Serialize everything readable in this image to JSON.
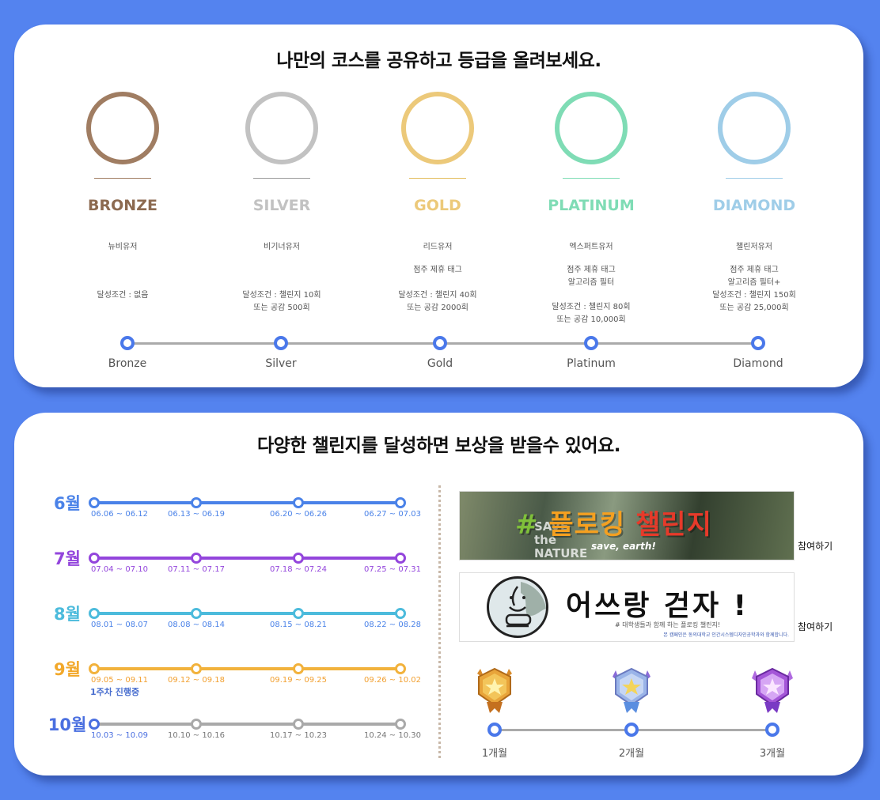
{
  "tiers_section": {
    "title": "나만의 코스를 공유하고 등급을 올려보세요.",
    "tiers": [
      {
        "name": "BRONZE",
        "color": "#a07d62",
        "rule_color": "#a07d62",
        "subtitle": "뉴비유저",
        "perks": "",
        "condition": "달성조건 : 없음"
      },
      {
        "name": "SILVER",
        "color": "#c2c2c2",
        "rule_color": "#9a9a9a",
        "subtitle": "비기너유저",
        "perks": "",
        "condition": "달성조건 : 챌린지 10회\n또는 공감 500회"
      },
      {
        "name": "GOLD",
        "color": "#ecc97a",
        "rule_color": "#e3bb5a",
        "subtitle": "리드유저",
        "perks": "점주 제휴 태그",
        "condition": "달성조건 : 챌린지 40회\n또는 공감 2000회"
      },
      {
        "name": "PLATINUM",
        "color": "#7fdcb5",
        "rule_color": "#7fdcb5",
        "subtitle": "엑스퍼트유저",
        "perks": "점주 제휴 태그\n알고리즘 필터",
        "condition": "달성조건 : 챌린지 80회\n또는 공감 10,000회"
      },
      {
        "name": "DIAMOND",
        "color": "#9fcde8",
        "rule_color": "#9fcde8",
        "subtitle": "챌린저유저",
        "perks": "점주 제휴 태그\n알고리즘 필터+",
        "condition": "달성조건 : 챌린지 150회\n또는 공감 25,000회"
      }
    ],
    "progress_labels": [
      "Bronze",
      "Silver",
      "Gold",
      "Platinum",
      "Diamond"
    ]
  },
  "challenge_section": {
    "title": "다양한 챌린지를 달성하면 보상을 받을수 있어요.",
    "months": [
      {
        "label": "6월",
        "color": "#4a82e8",
        "label_color": "#4a82e8",
        "range_color": "#4a82e8",
        "status": "",
        "ranges": [
          "06.06 ~ 06.12",
          "06.13 ~ 06.19",
          "06.20 ~ 06.26",
          "06.27 ~ 07.03"
        ]
      },
      {
        "label": "7월",
        "color": "#9345dc",
        "label_color": "#9345dc",
        "range_color": "#9345dc",
        "status": "",
        "ranges": [
          "07.04 ~ 07.10",
          "07.11 ~ 07.17",
          "07.18 ~ 07.24",
          "07.25 ~ 07.31"
        ]
      },
      {
        "label": "8월",
        "color": "#4cbbdc",
        "label_color": "#4cbbdc",
        "range_color": "#4a82e8",
        "status": "",
        "ranges": [
          "08.01 ~ 08.07",
          "08.08 ~ 08.14",
          "08.15 ~ 08.21",
          "08.22 ~ 08.28"
        ]
      },
      {
        "label": "9월",
        "color": "#f2b23c",
        "label_color": "#f2a82a",
        "range_color": "#f2a030",
        "status": "",
        "ranges": [
          "09.05 ~ 09.11",
          "09.12 ~ 09.18",
          "09.19 ~ 09.25",
          "09.26 ~ 10.02"
        ]
      },
      {
        "label": "10월",
        "color": "#a9a9a9",
        "label_color": "#4a6fe0",
        "range_color": "#777777",
        "status": "1주차 진행중",
        "first_color": "#4a6fe0",
        "ranges": [
          "10.03 ~ 10.09",
          "10.10 ~ 10.16",
          "10.17 ~ 10.23",
          "10.24 ~ 10.30"
        ]
      }
    ],
    "challenges": [
      {
        "hash": "#",
        "word1": "플로킹",
        "word2": "챌린지",
        "subtitle": "save, earth!",
        "deco": "SAVE\nthe\nNATURE",
        "join": "참여하기"
      },
      {
        "title": "어쓰랑 걷자 !",
        "subtitle": "# 대학생들과 함께 하는 플로킹 챌린지!",
        "credit": "본 캠페인은 동의대학교 인간시스템디자인공학과와 함께합니다.",
        "join": "참여하기"
      }
    ],
    "rewards": [
      {
        "label": "1개월",
        "medal": "bronze-medal-icon"
      },
      {
        "label": "2개월",
        "medal": "silver-medal-icon"
      },
      {
        "label": "3개월",
        "medal": "purple-medal-icon"
      }
    ]
  }
}
